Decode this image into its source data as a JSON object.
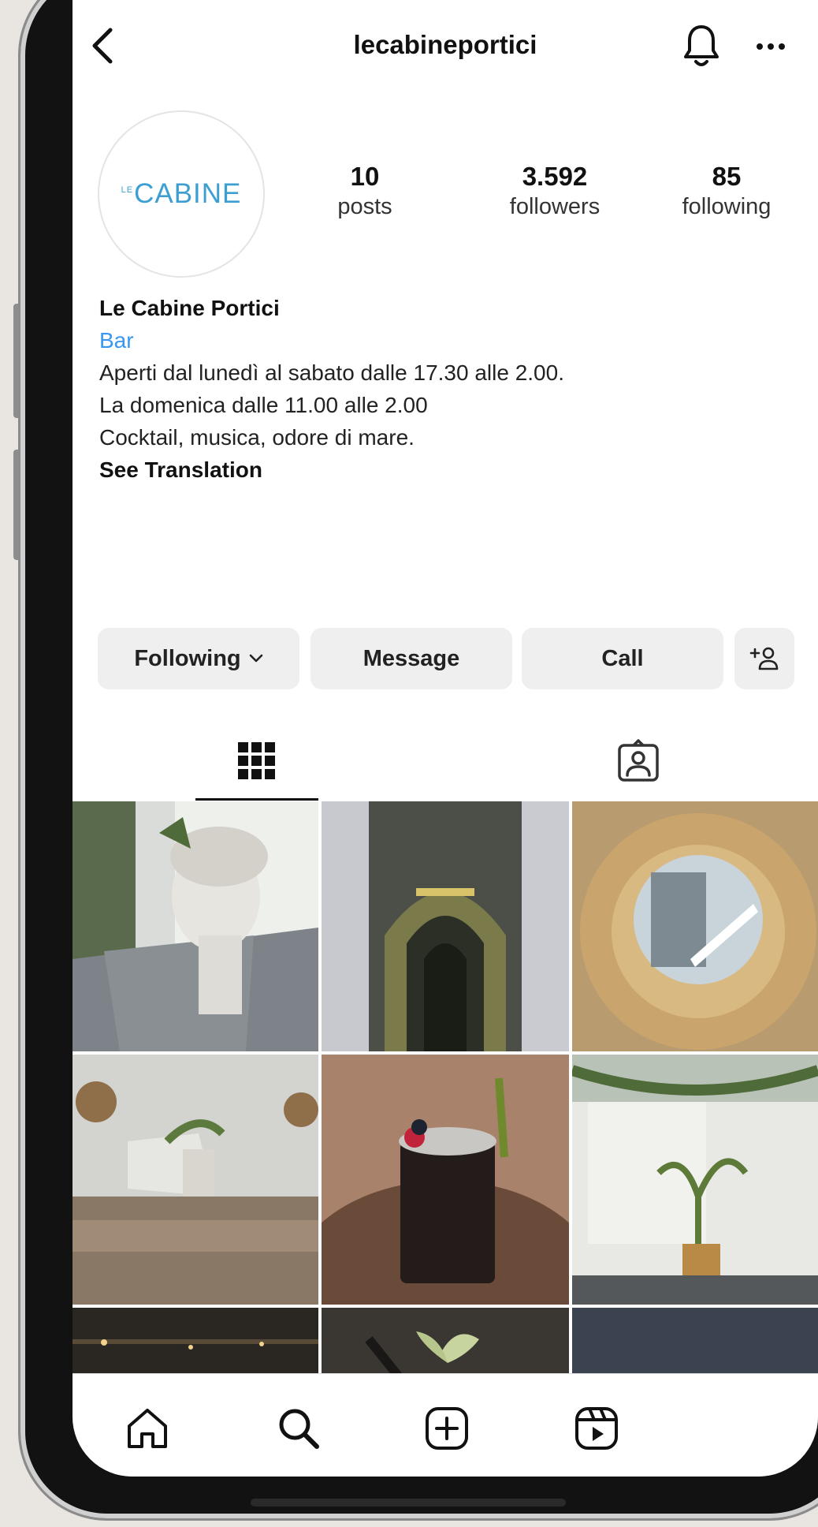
{
  "header": {
    "username": "lecabineportici"
  },
  "profile": {
    "avatar_text": "CABINE",
    "avatar_small": "LE",
    "stats": [
      {
        "value": "10",
        "label": "posts"
      },
      {
        "value": "3.592",
        "label": "followers"
      },
      {
        "value": "85",
        "label": "following"
      }
    ]
  },
  "bio": {
    "name": "Le Cabine Portici",
    "category": "Bar",
    "lines": [
      "Aperti dal lunedì al sabato dalle 17.30 alle 2.00.",
      "La domenica dalle 11.00 alle 2.00",
      "Cocktail, musica, odore di mare."
    ],
    "translation": "See Translation"
  },
  "actions": {
    "following": "Following",
    "message": "Message",
    "call": "Call"
  },
  "tabs": [
    "grid-icon",
    "tagged-icon"
  ],
  "nav": [
    "home-icon",
    "search-icon",
    "new-post-icon",
    "reels-icon"
  ],
  "colors": {
    "link_blue": "#3897f0",
    "logo_blue": "#3d9fd1",
    "button_gray": "#efefef"
  }
}
